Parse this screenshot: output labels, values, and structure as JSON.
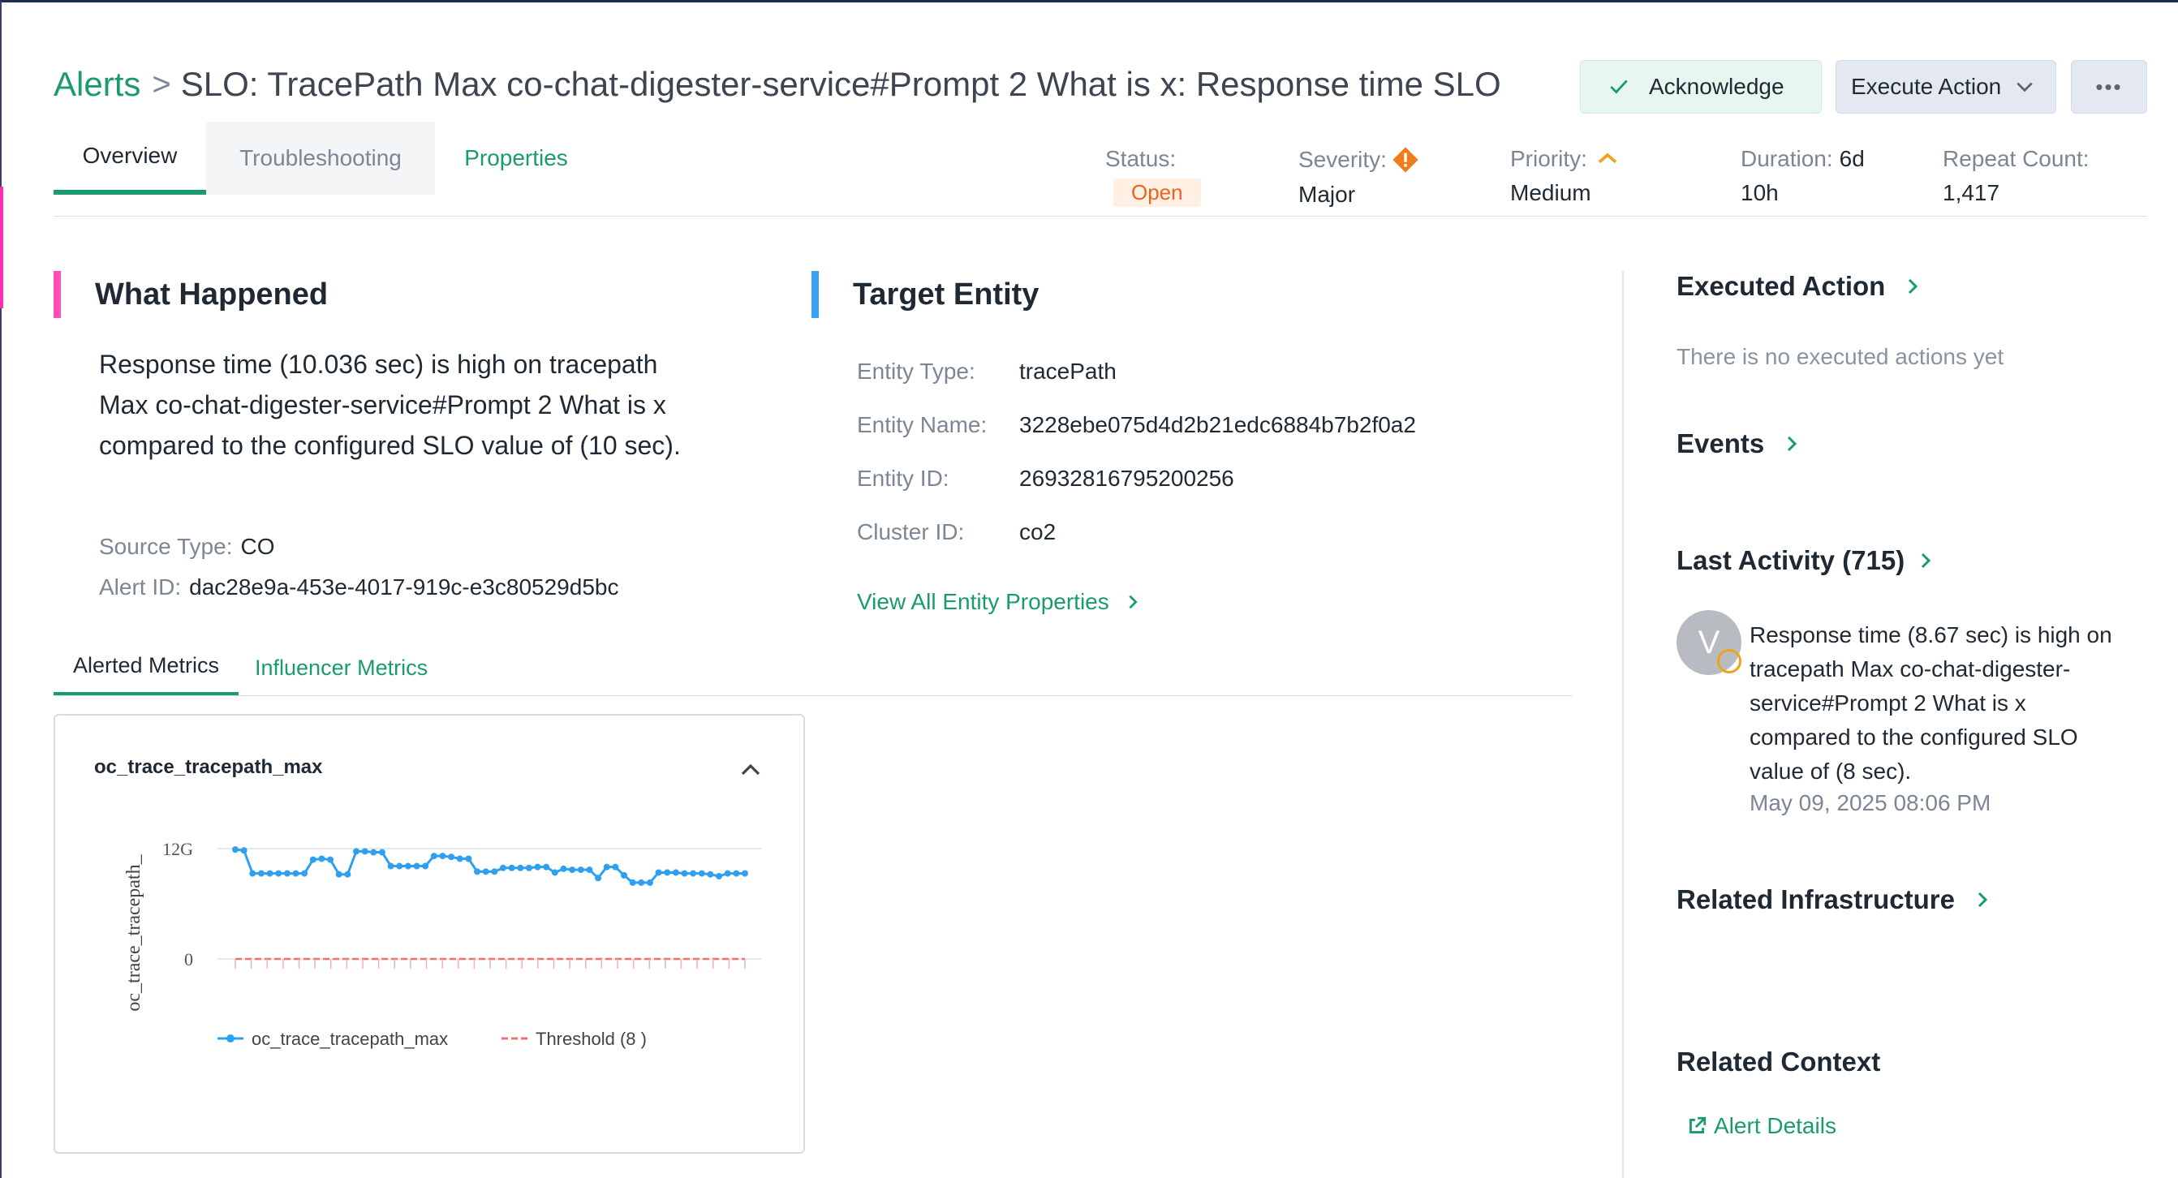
{
  "breadcrumb": {
    "root": "Alerts",
    "separator": ">"
  },
  "page_title": "SLO: TracePath Max co-chat-digester-service#Prompt 2 What is x: Response time SLO",
  "actions": {
    "acknowledge": "Acknowledge",
    "execute": "Execute Action",
    "more": "•••"
  },
  "tabs": [
    "Overview",
    "Troubleshooting",
    "Properties"
  ],
  "meta": {
    "status_label": "Status:",
    "status_value": "Open",
    "severity_label": "Severity:",
    "severity_value": "Major",
    "priority_label": "Priority:",
    "priority_value": "Medium",
    "duration_label": "Duration:",
    "duration_value_a": "6d",
    "duration_value_b": "10h",
    "repeat_label": "Repeat Count:",
    "repeat_value": "1,417"
  },
  "what_happened": {
    "title": "What Happened",
    "description": "Response time (10.036 sec) is high on tracepath Max co-chat-digester-service#Prompt 2 What is x compared to the configured SLO value of (10 sec).",
    "source_type_label": "Source Type:",
    "source_type_value": "CO",
    "alert_id_label": "Alert ID:",
    "alert_id_value": "dac28e9a-453e-4017-919c-e3c80529d5bc"
  },
  "target_entity": {
    "title": "Target Entity",
    "rows": [
      {
        "label": "Entity Type:",
        "value": "tracePath"
      },
      {
        "label": "Entity Name:",
        "value": "3228ebe075d4d2b21edc6884b7b2f0a2"
      },
      {
        "label": "Entity ID:",
        "value": "26932816795200256"
      },
      {
        "label": "Cluster ID:",
        "value": "co2"
      }
    ],
    "link": "View All Entity Properties"
  },
  "metric_tabs": [
    "Alerted Metrics",
    "Influencer Metrics"
  ],
  "metric_card": {
    "title": "oc_trace_tracepath_max"
  },
  "chart_data": {
    "type": "line",
    "ylabel": "oc_trace_tracepath_",
    "yticks": [
      "12G",
      "0"
    ],
    "ylim": [
      0,
      12
    ],
    "series": [
      {
        "name": "oc_trace_tracepath_max",
        "color": "#2f9ff0",
        "values": [
          11.9,
          11.8,
          9.3,
          9.3,
          9.3,
          9.3,
          9.3,
          9.3,
          9.3,
          10.8,
          10.9,
          10.8,
          9.2,
          9.2,
          11.7,
          11.7,
          11.6,
          11.6,
          10.1,
          10.1,
          10.1,
          10.1,
          10.1,
          11.2,
          11.2,
          11.1,
          10.9,
          10.9,
          9.5,
          9.5,
          9.5,
          9.9,
          9.9,
          9.9,
          9.9,
          10.0,
          10.0,
          9.4,
          9.8,
          9.7,
          9.7,
          9.7,
          8.8,
          10.0,
          10.0,
          9.1,
          8.3,
          8.3,
          8.3,
          9.4,
          9.4,
          9.4,
          9.3,
          9.3,
          9.3,
          9.2,
          9.0,
          9.3,
          9.3,
          9.3
        ]
      },
      {
        "name": "Threshold (8 )",
        "color": "#f0716a",
        "style": "dashed",
        "values": [
          0,
          0
        ]
      }
    ],
    "legend": "bottom",
    "grid": true
  },
  "right_panel": {
    "executed_action": "Executed Action",
    "executed_empty": "There is no executed actions yet",
    "events": "Events",
    "last_activity": "Last Activity (715)",
    "activity": {
      "avatar": "V",
      "text": "Response time (8.67 sec) is high on tracepath Max co-chat-digester-service#Prompt 2 What is x compared to the configured SLO value of (8 sec).",
      "time": "May 09, 2025 08:06 PM"
    },
    "related_infrastructure": "Related Infrastructure",
    "related_context": "Related Context",
    "alert_details": "Alert Details"
  },
  "colors": {
    "accent": "#1a9b6c",
    "what_happened_bar": "#ff4db8",
    "target_entity_bar": "#3aa1f2",
    "severity": "#f07c1b",
    "priority": "#f0a21b"
  }
}
